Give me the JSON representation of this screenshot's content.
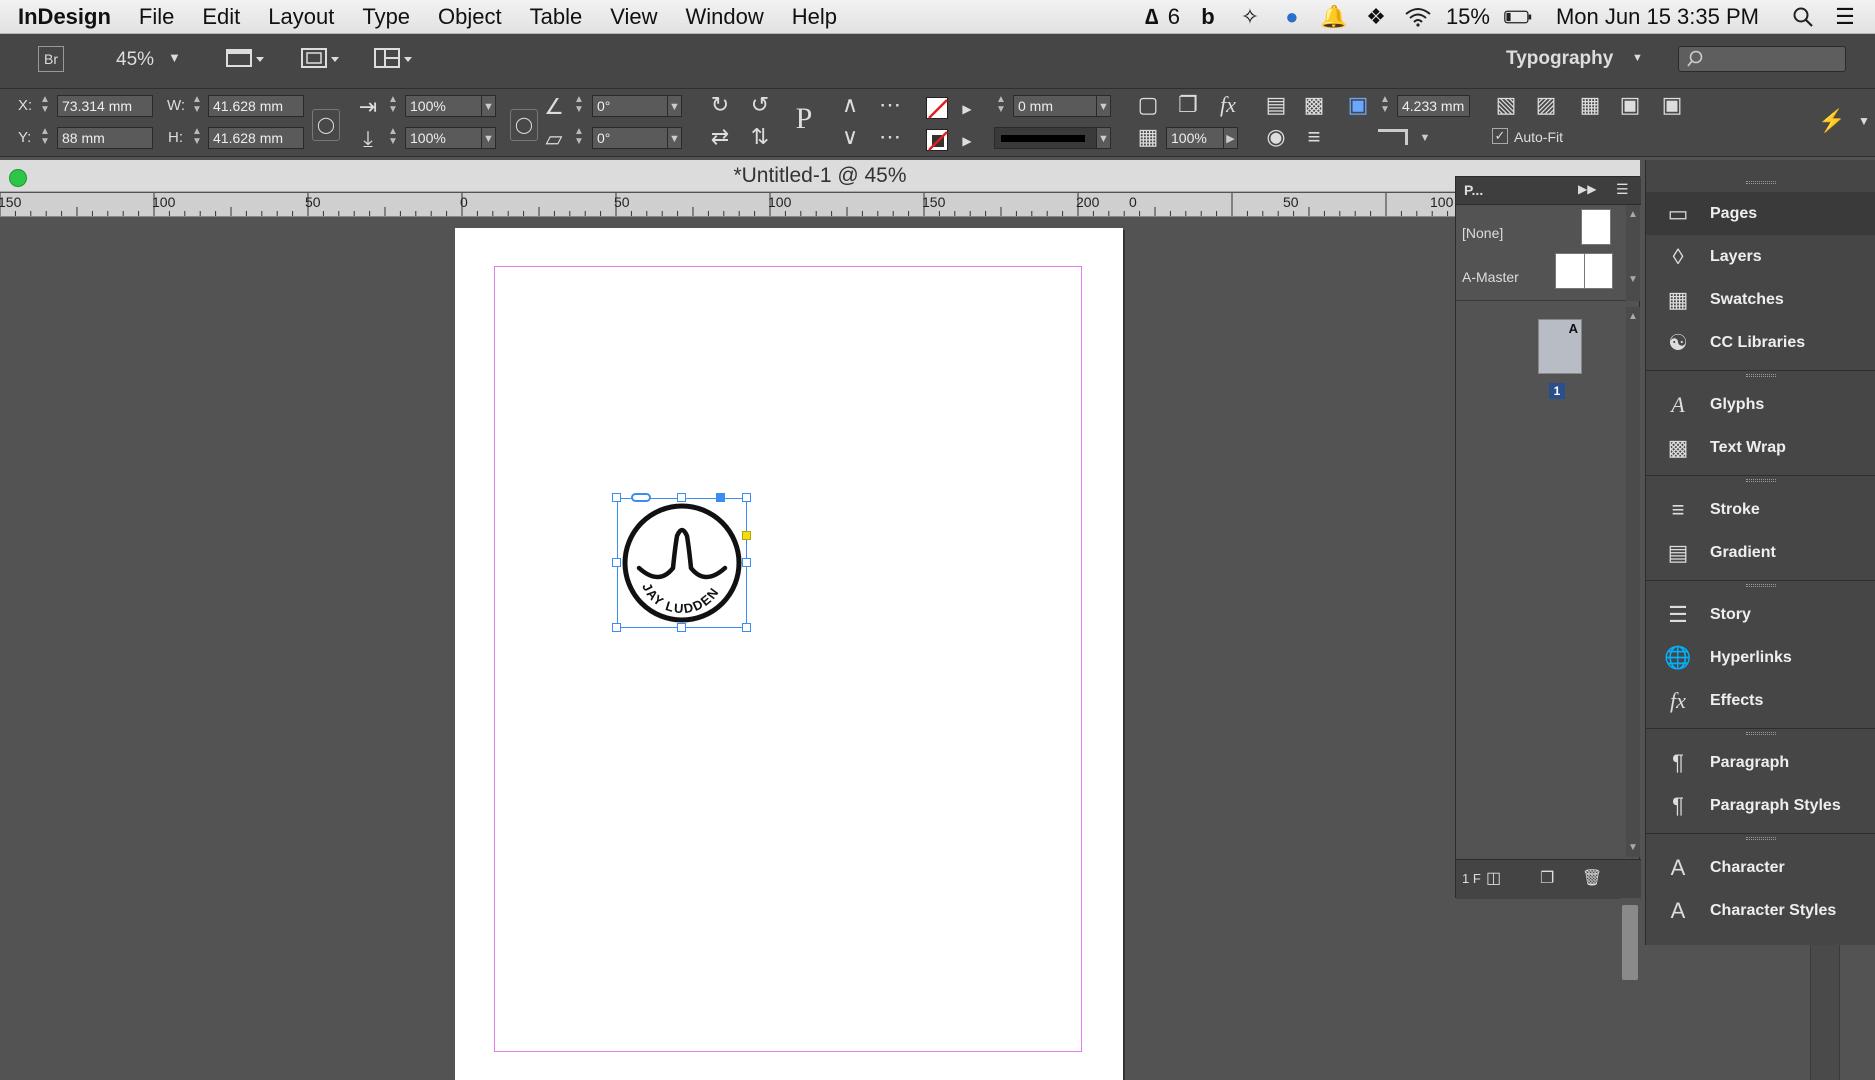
{
  "menubar": {
    "app_name": "InDesign",
    "items": [
      "File",
      "Edit",
      "Layout",
      "Type",
      "Object",
      "Table",
      "View",
      "Window",
      "Help"
    ],
    "status": {
      "adobe_badge": "6",
      "battery": "15%",
      "clock": "Mon Jun 15  3:35 PM"
    }
  },
  "appbar": {
    "bridge_label": "Br",
    "zoom": "45%",
    "workspace": "Typography",
    "search_placeholder": ""
  },
  "control": {
    "x_label": "X:",
    "x_value": "73.314 mm",
    "y_label": "Y:",
    "y_value": "88 mm",
    "w_label": "W:",
    "w_value": "41.628 mm",
    "h_label": "H:",
    "h_value": "41.628 mm",
    "scale_x": "100%",
    "scale_y": "100%",
    "rotate": "0°",
    "shear": "0°",
    "stroke_weight": "0 mm",
    "opacity": "100%",
    "fit_offset": "4.233 mm",
    "autofit_label": "Auto-Fit"
  },
  "document": {
    "title": "*Untitled-1 @ 45%",
    "ruler_labels": [
      "150",
      "100",
      "50",
      "0",
      "50",
      "100",
      "150",
      "200",
      "0",
      "50",
      "100"
    ],
    "stamp_text": "JAY LUDDEN"
  },
  "pages_panel": {
    "tab": "P...",
    "none_label": "[None]",
    "master_label": "A-Master",
    "page_master_letter": "A",
    "page_number": "1",
    "footer": "1 F"
  },
  "dock": {
    "groups": [
      [
        "Pages",
        "Layers",
        "Swatches",
        "CC Libraries"
      ],
      [
        "Glyphs",
        "Text Wrap"
      ],
      [
        "Stroke",
        "Gradient"
      ],
      [
        "Story",
        "Hyperlinks",
        "Effects"
      ],
      [
        "Paragraph",
        "Paragraph Styles"
      ],
      [
        "Character",
        "Character Styles"
      ]
    ],
    "active": "Pages"
  },
  "colors": {
    "selection": "#3b8ef0",
    "margin_guide": "#e080e8",
    "traffic_green": "#2ec54a"
  }
}
